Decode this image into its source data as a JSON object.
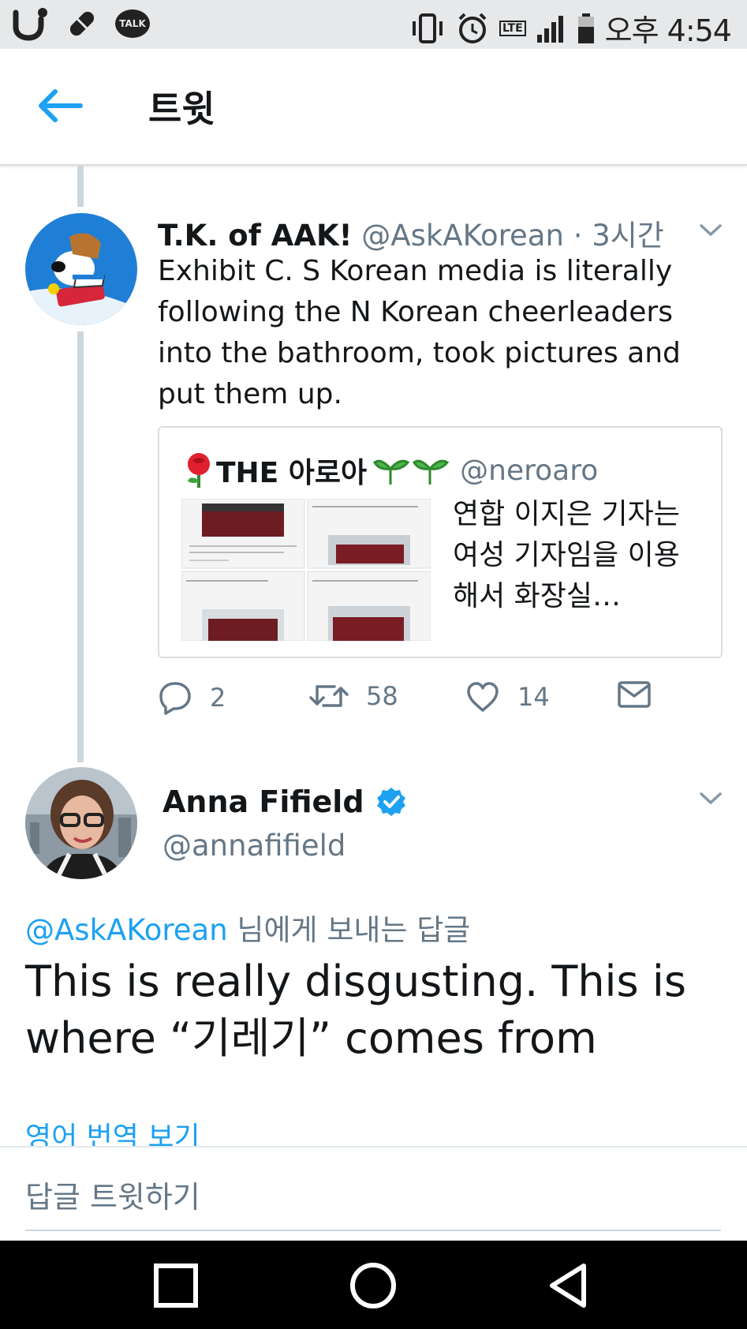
{
  "status_bar": {
    "talk_label": "TALK",
    "network": "LTE",
    "time": "오후 4:54"
  },
  "header": {
    "title": "트윗"
  },
  "tweet1": {
    "name": "T.K. of AAK!",
    "handle": "@AskAKorean",
    "time": "· 3시간",
    "text": "Exhibit C. S Korean media is literally following the N Korean cheerleaders into the bathroom, took pictures and put them up.",
    "quote": {
      "name": "THE 아로아",
      "handle": "@neroaro",
      "text": "연합 이지은 기자는 여성 기자임을 이용해서 화장실…"
    },
    "actions": {
      "replies": "2",
      "retweets": "58",
      "likes": "14"
    }
  },
  "tweet2": {
    "name": "Anna Fifield",
    "handle": "@annafifield",
    "reply_mention": "@AskAKorean",
    "reply_suffix": " 님에게 보내는 답글",
    "text": "This is really disgusting. This is where “기레기” comes from",
    "translate_link": "영어 번역 보기"
  },
  "reply_bar": {
    "placeholder": "답글 트윗하기"
  },
  "colors": {
    "accent": "#1da1f2",
    "secondary_text": "#657786",
    "primary_text": "#14171a",
    "thread_line": "#ccd6dd"
  }
}
